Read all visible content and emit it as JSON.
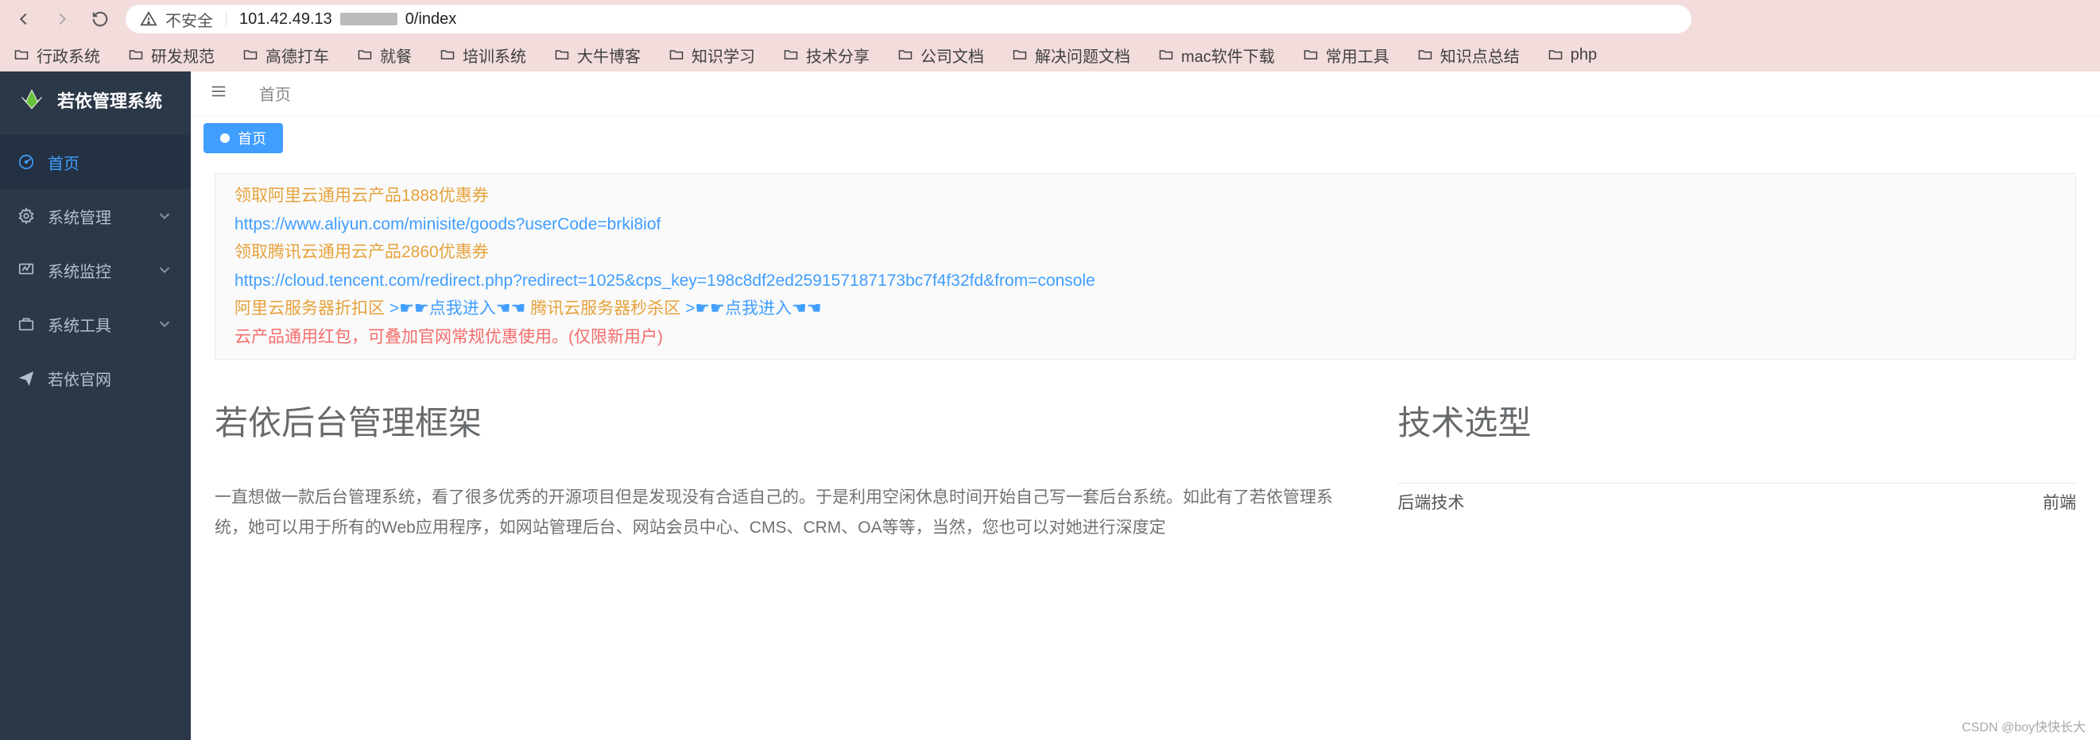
{
  "browser": {
    "security_label": "不安全",
    "url_prefix": "101.42.49.13",
    "url_suffix": "0/index",
    "bookmarks": [
      "行政系统",
      "研发规范",
      "高德打车",
      "就餐",
      "培训系统",
      "大牛博客",
      "知识学习",
      "技术分享",
      "公司文档",
      "解决问题文档",
      "mac软件下载",
      "常用工具",
      "知识点总结",
      "php"
    ]
  },
  "sidebar": {
    "brand": "若依管理系统",
    "items": [
      {
        "label": "首页",
        "expandable": false
      },
      {
        "label": "系统管理",
        "expandable": true
      },
      {
        "label": "系统监控",
        "expandable": true
      },
      {
        "label": "系统工具",
        "expandable": true
      },
      {
        "label": "若依官网",
        "expandable": false
      }
    ]
  },
  "topbar": {
    "breadcrumb": "首页"
  },
  "tabs": {
    "active_label": "首页"
  },
  "promo": {
    "line1": "领取阿里云通用云产品1888优惠券",
    "link1": "https://www.aliyun.com/minisite/goods?userCode=brki8iof",
    "line2": "领取腾讯云通用云产品2860优惠券",
    "link2": "https://cloud.tencent.com/redirect.php?redirect=1025&cps_key=198c8df2ed259157187173bc7f4f32fd&from=console",
    "line3_a": "阿里云服务器折扣区 ",
    "line3_click1": ">☛☛点我进入☚☚ ",
    "line3_b": "腾讯云服务器秒杀区 ",
    "line3_click2": ">☛☛点我进入☚☚",
    "line4": "云产品通用红包，可叠加官网常规优惠使用。(仅限新用户)"
  },
  "content": {
    "title_left": "若依后台管理框架",
    "paragraph": "一直想做一款后台管理系统，看了很多优秀的开源项目但是发现没有合适自己的。于是利用空闲休息时间开始自己写一套后台系统。如此有了若依管理系统，她可以用于所有的Web应用程序，如网站管理后台、网站会员中心、CMS、CRM、OA等等，当然，您也可以对她进行深度定",
    "title_right": "技术选型",
    "tech_backend_label": "后端技术",
    "tech_frontend_label": "前端"
  },
  "watermark": "CSDN @boy快快长大"
}
